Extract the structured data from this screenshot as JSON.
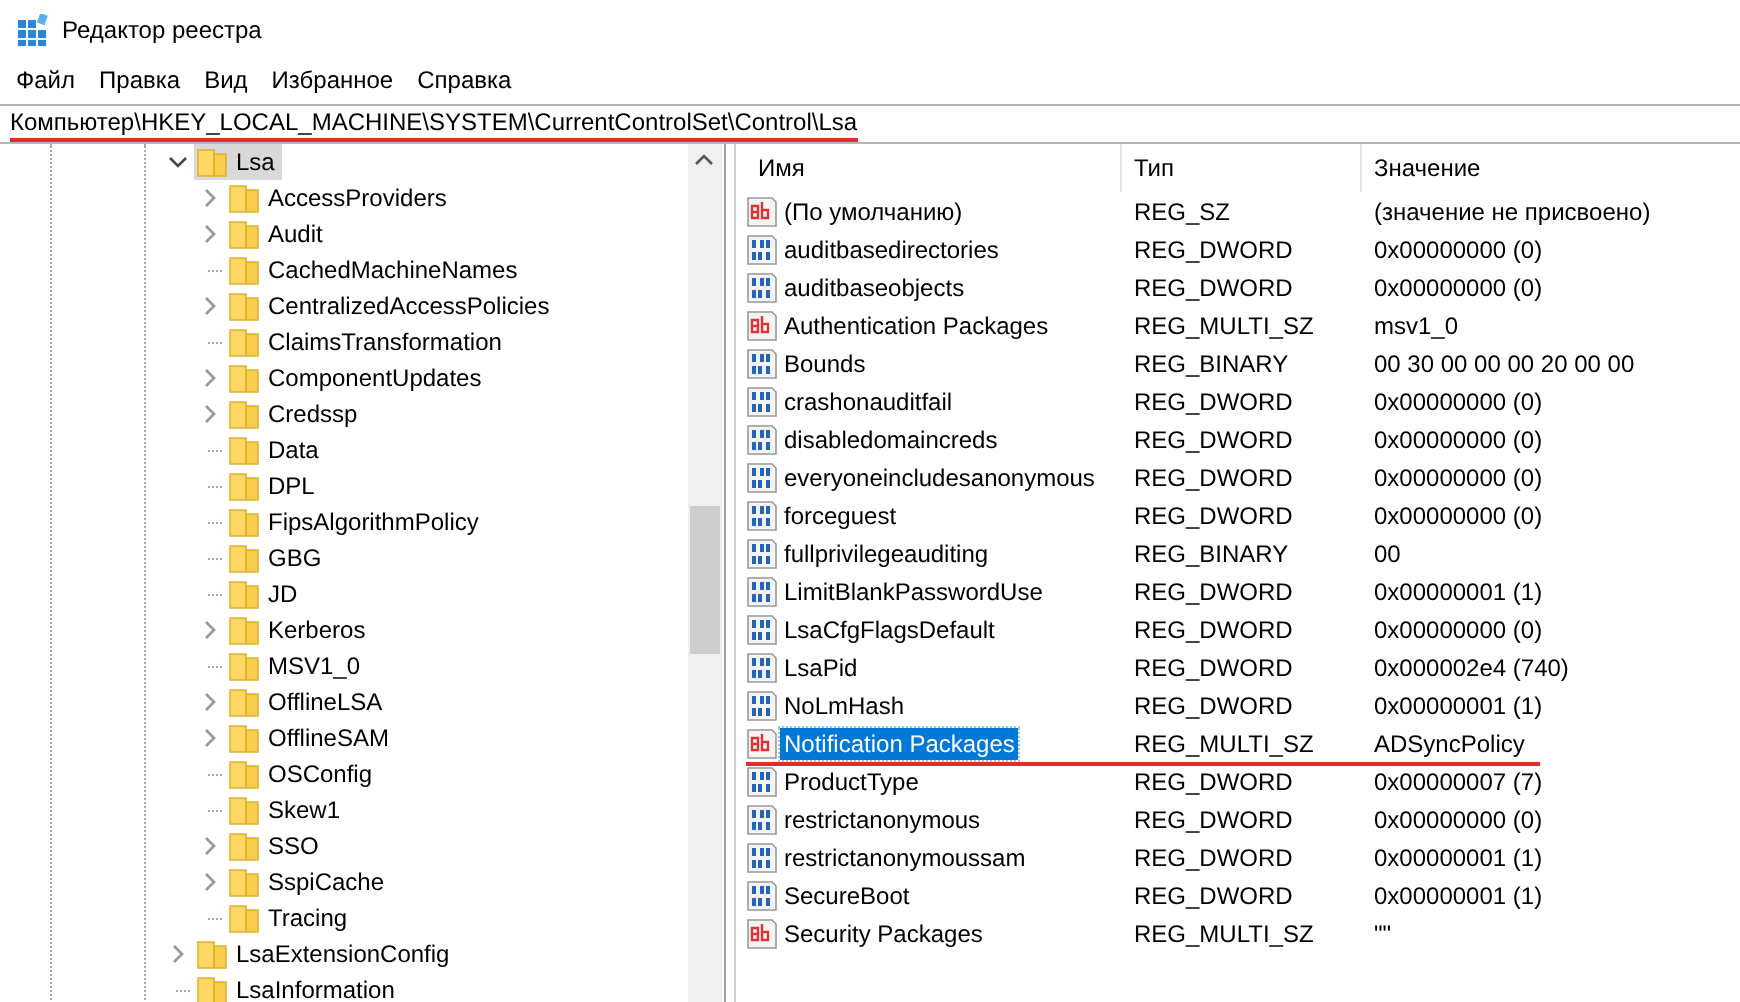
{
  "window": {
    "title": "Редактор реестра"
  },
  "menu": [
    "Файл",
    "Правка",
    "Вид",
    "Избранное",
    "Справка"
  ],
  "address": {
    "value": "Компьютер\\HKEY_LOCAL_MACHINE\\SYSTEM\\CurrentControlSet\\Control\\Lsa",
    "underlined": true
  },
  "tree": [
    {
      "label": "Lsa",
      "expanded": true,
      "selected": true,
      "children": [
        {
          "label": "AccessProviders",
          "has_children": true
        },
        {
          "label": "Audit",
          "has_children": true
        },
        {
          "label": "CachedMachineNames",
          "has_children": false
        },
        {
          "label": "CentralizedAccessPolicies",
          "has_children": true
        },
        {
          "label": "ClaimsTransformation",
          "has_children": false
        },
        {
          "label": "ComponentUpdates",
          "has_children": true
        },
        {
          "label": "Credssp",
          "has_children": true
        },
        {
          "label": "Data",
          "has_children": false
        },
        {
          "label": "DPL",
          "has_children": false
        },
        {
          "label": "FipsAlgorithmPolicy",
          "has_children": false
        },
        {
          "label": "GBG",
          "has_children": false
        },
        {
          "label": "JD",
          "has_children": false
        },
        {
          "label": "Kerberos",
          "has_children": true
        },
        {
          "label": "MSV1_0",
          "has_children": false
        },
        {
          "label": "OfflineLSA",
          "has_children": true
        },
        {
          "label": "OfflineSAM",
          "has_children": true
        },
        {
          "label": "OSConfig",
          "has_children": false
        },
        {
          "label": "Skew1",
          "has_children": false
        },
        {
          "label": "SSO",
          "has_children": true
        },
        {
          "label": "SspiCache",
          "has_children": true
        },
        {
          "label": "Tracing",
          "has_children": false
        }
      ]
    },
    {
      "label": "LsaExtensionConfig",
      "has_children": true,
      "expanded": false,
      "selected": false
    },
    {
      "label": "LsaInformation",
      "has_children": false,
      "expanded": false,
      "selected": false
    }
  ],
  "table": {
    "columns": [
      "Имя",
      "Тип",
      "Значение"
    ],
    "rows": [
      {
        "kind": "string",
        "name": "(По умолчанию)",
        "type": "REG_SZ",
        "value": "(значение не присвоено)",
        "selected": false
      },
      {
        "kind": "binary",
        "name": "auditbasedirectories",
        "type": "REG_DWORD",
        "value": "0x00000000 (0)",
        "selected": false
      },
      {
        "kind": "binary",
        "name": "auditbaseobjects",
        "type": "REG_DWORD",
        "value": "0x00000000 (0)",
        "selected": false
      },
      {
        "kind": "string",
        "name": "Authentication Packages",
        "type": "REG_MULTI_SZ",
        "value": "msv1_0",
        "selected": false
      },
      {
        "kind": "binary",
        "name": "Bounds",
        "type": "REG_BINARY",
        "value": "00 30 00 00 00 20 00 00",
        "selected": false
      },
      {
        "kind": "binary",
        "name": "crashonauditfail",
        "type": "REG_DWORD",
        "value": "0x00000000 (0)",
        "selected": false
      },
      {
        "kind": "binary",
        "name": "disabledomaincreds",
        "type": "REG_DWORD",
        "value": "0x00000000 (0)",
        "selected": false
      },
      {
        "kind": "binary",
        "name": "everyoneincludesanonymous",
        "type": "REG_DWORD",
        "value": "0x00000000 (0)",
        "selected": false
      },
      {
        "kind": "binary",
        "name": "forceguest",
        "type": "REG_DWORD",
        "value": "0x00000000 (0)",
        "selected": false
      },
      {
        "kind": "binary",
        "name": "fullprivilegeauditing",
        "type": "REG_BINARY",
        "value": "00",
        "selected": false
      },
      {
        "kind": "binary",
        "name": "LimitBlankPasswordUse",
        "type": "REG_DWORD",
        "value": "0x00000001 (1)",
        "selected": false
      },
      {
        "kind": "binary",
        "name": "LsaCfgFlagsDefault",
        "type": "REG_DWORD",
        "value": "0x00000000 (0)",
        "selected": false
      },
      {
        "kind": "binary",
        "name": "LsaPid",
        "type": "REG_DWORD",
        "value": "0x000002e4 (740)",
        "selected": false
      },
      {
        "kind": "binary",
        "name": "NoLmHash",
        "type": "REG_DWORD",
        "value": "0x00000001 (1)",
        "selected": false
      },
      {
        "kind": "string",
        "name": "Notification Packages",
        "type": "REG_MULTI_SZ",
        "value": "ADSyncPolicy",
        "selected": true,
        "underlined": true
      },
      {
        "kind": "binary",
        "name": "ProductType",
        "type": "REG_DWORD",
        "value": "0x00000007 (7)",
        "selected": false
      },
      {
        "kind": "binary",
        "name": "restrictanonymous",
        "type": "REG_DWORD",
        "value": "0x00000000 (0)",
        "selected": false
      },
      {
        "kind": "binary",
        "name": "restrictanonymoussam",
        "type": "REG_DWORD",
        "value": "0x00000001 (1)",
        "selected": false
      },
      {
        "kind": "binary",
        "name": "SecureBoot",
        "type": "REG_DWORD",
        "value": "0x00000001 (1)",
        "selected": false
      },
      {
        "kind": "string",
        "name": "Security Packages",
        "type": "REG_MULTI_SZ",
        "value": "\"\"",
        "selected": false
      }
    ]
  }
}
